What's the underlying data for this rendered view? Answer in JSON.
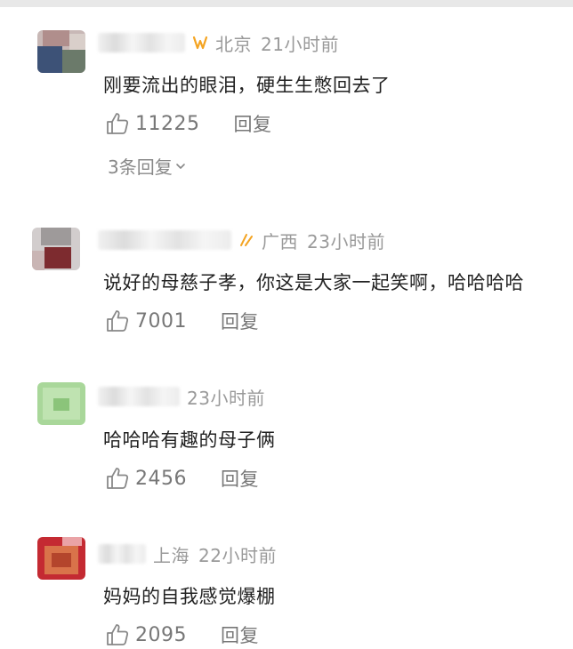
{
  "colors": {
    "meta_gray": "#9a9a9a",
    "action_gray": "#777777",
    "vip_gold": "#f4a422",
    "text": "#222222"
  },
  "comments": [
    {
      "location": "北京",
      "time": "21小时前",
      "text": "刚要流出的眼泪，硬生生憋回去了",
      "likes": "11225",
      "reply_label": "回复",
      "reply_count_label": "3条回复",
      "reply_icon": "chevron-down-icon",
      "vip_icon": "vip-badge-icon"
    },
    {
      "location": "广西",
      "time": "23小时前",
      "text": "说好的母慈子孝，你这是大家一起笑啊，哈哈哈哈",
      "likes": "7001",
      "reply_label": "回复",
      "vip_icon": "vip-badge-icon"
    },
    {
      "time": "23小时前",
      "text": "哈哈哈有趣的母子俩",
      "likes": "2456",
      "reply_label": "回复"
    },
    {
      "location": "上海",
      "time": "22小时前",
      "text": "妈妈的自我感觉爆棚",
      "likes": "2095",
      "reply_label": "回复"
    }
  ]
}
